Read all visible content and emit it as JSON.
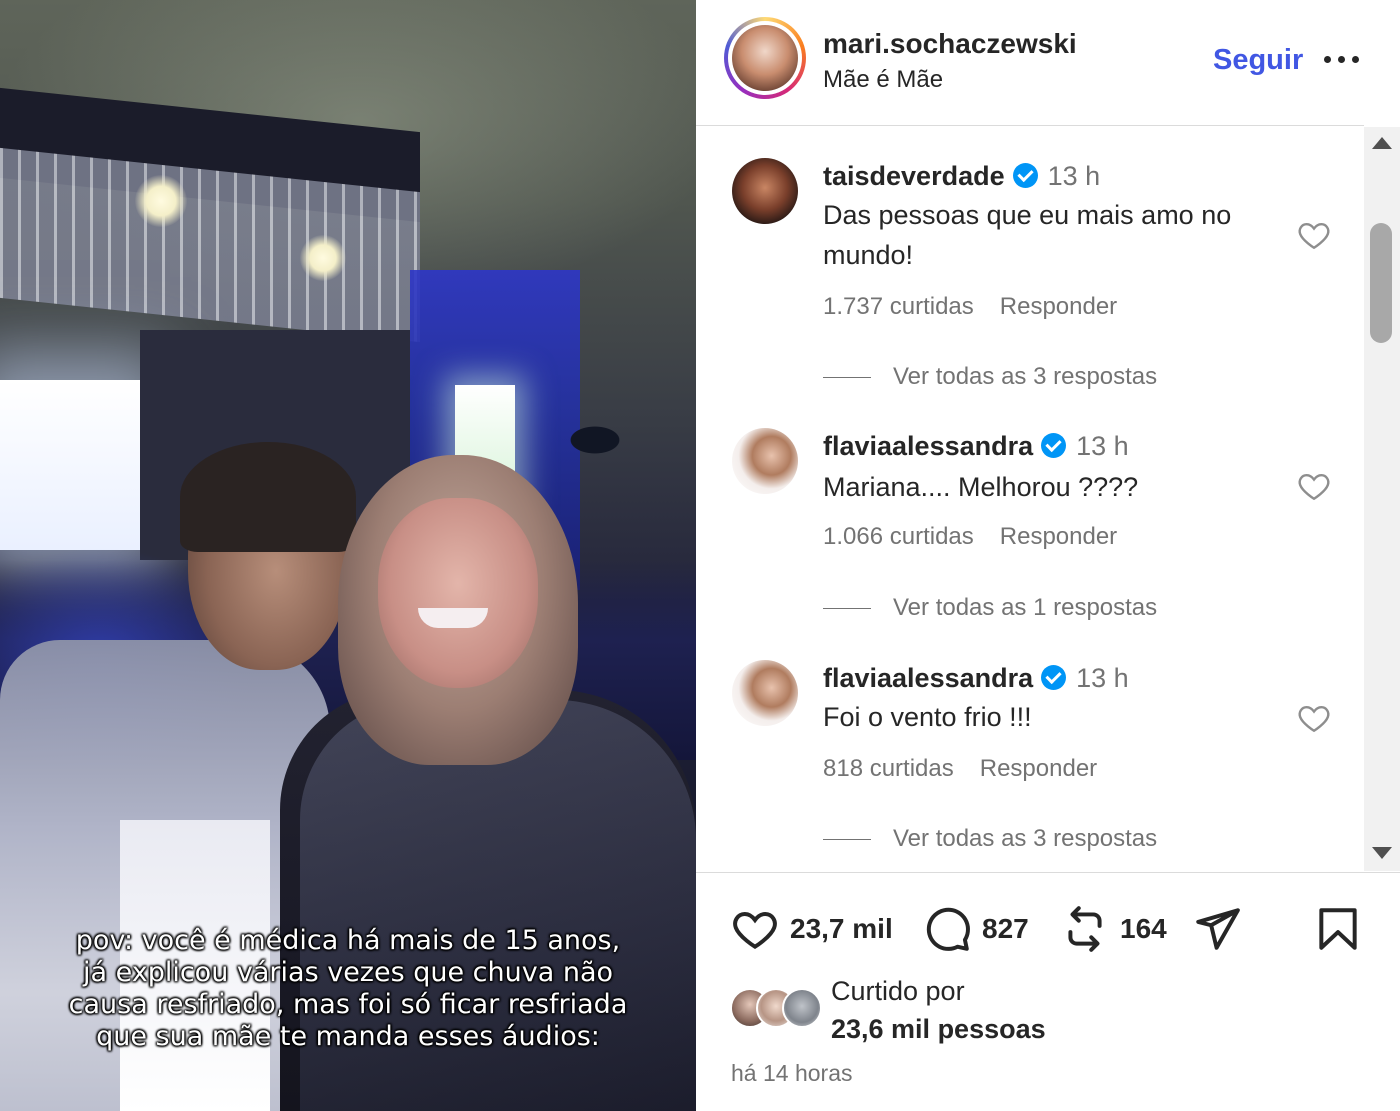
{
  "media": {
    "caption": "pov: você é médica há mais de 15 anos,\njá explicou várias vezes que chuva não\ncausa resfriado, mas foi só ficar resfriada\nque sua mãe te manda esses áudios:"
  },
  "header": {
    "username": "mari.sochaczewski",
    "subtitle": "Mãe é Mãe",
    "follow_label": "Seguir",
    "more_icon": "more-horizontal-icon"
  },
  "comments": [
    {
      "username": "taisdeverdade",
      "verified": true,
      "time": "13 h",
      "text": "Das pessoas que eu mais amo no mundo!",
      "likes": "1.737 curtidas",
      "reply_label": "Responder",
      "view_replies": "Ver todas as 3 respostas"
    },
    {
      "username": "flaviaalessandra",
      "verified": true,
      "time": "13 h",
      "text": "Mariana.... Melhorou ????",
      "likes": "1.066 curtidas",
      "reply_label": "Responder",
      "view_replies": "Ver todas as 1 respostas"
    },
    {
      "username": "flaviaalessandra",
      "verified": true,
      "time": "13 h",
      "text": "Foi o vento frio !!!",
      "likes": "818 curtidas",
      "reply_label": "Responder",
      "view_replies": "Ver todas as 3 respostas"
    }
  ],
  "actions": {
    "likes": "23,7 mil",
    "comments": "827",
    "reposts": "164"
  },
  "liked_by": {
    "prefix": "Curtido por",
    "count": "23,6 mil pessoas"
  },
  "post_time": "há 14 horas",
  "colors": {
    "accent": "#4157e3",
    "verified": "#0095f6",
    "text": "#262626",
    "muted": "#737373"
  }
}
